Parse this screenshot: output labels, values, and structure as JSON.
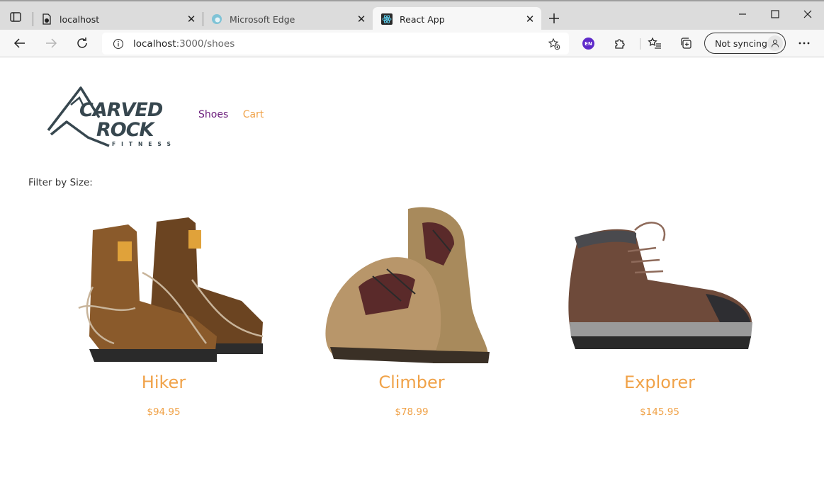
{
  "browser": {
    "tabs": [
      {
        "title": "localhost",
        "active": false
      },
      {
        "title": "Microsoft Edge",
        "active": false
      },
      {
        "title": "React App",
        "active": true
      }
    ],
    "address": {
      "host": "localhost",
      "path": ":3000/shoes"
    },
    "extension_badge": "EN",
    "sync_label": "Not syncing"
  },
  "nav": {
    "shoes_label": "Shoes",
    "cart_label": "Cart"
  },
  "filter_label": "Filter by Size:",
  "products": [
    {
      "name": "Hiker",
      "price": "$94.95"
    },
    {
      "name": "Climber",
      "price": "$78.99"
    },
    {
      "name": "Explorer",
      "price": "$145.95"
    }
  ],
  "colors": {
    "accent": "#f0a248",
    "nav_active": "#6a1b7a",
    "logo": "#37474f"
  },
  "icons": {
    "tab_actions": "tab-actions-icon",
    "new_tab": "plus-icon",
    "back": "back-arrow-icon",
    "forward": "forward-arrow-icon",
    "refresh": "refresh-icon",
    "info": "info-icon",
    "favorite_add": "star-plus-icon",
    "extensions": "puzzle-icon",
    "favorites": "favorites-icon",
    "collections": "collections-icon",
    "profile": "person-icon",
    "menu": "more-icon"
  }
}
